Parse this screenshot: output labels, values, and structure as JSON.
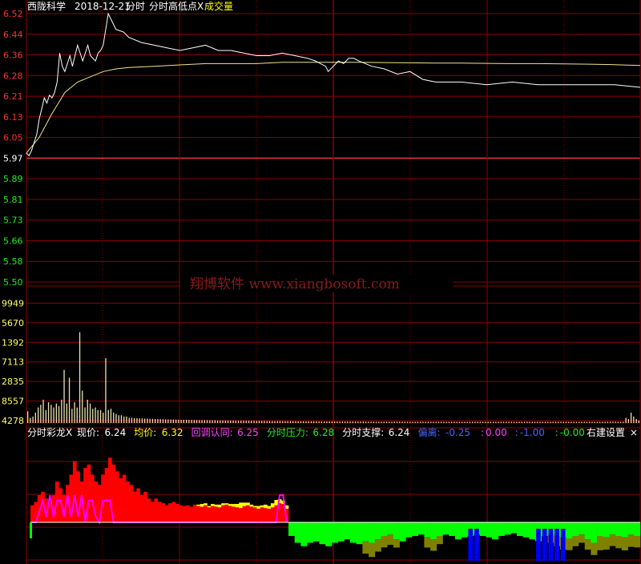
{
  "header": {
    "stock_name": "西陇科学",
    "date": "2018-12-21",
    "mode": "分时",
    "indicator": "分时高低点X",
    "indicator2": "成交量"
  },
  "watermark": "翔博软件 www.xiangbosoft.com",
  "colors": {
    "background": "#000000",
    "grid": "#8b0000",
    "price_line": "#ffffff",
    "avg_line": "#f0e68c",
    "up_label": "#ff3030",
    "down_label": "#22ee22",
    "volume": "#e8e4b0",
    "red_bar": "#ff0000",
    "yellow_bar": "#ffff00",
    "green_bar": "#00ff00",
    "blue_bar": "#0000ff",
    "magenta": "#ff00ff",
    "olive": "#808000"
  },
  "indicator_bar": {
    "name": "分时彩龙X",
    "items": [
      {
        "label": "现价:",
        "value": "6.24",
        "color": "#ffffff"
      },
      {
        "label": "均价:",
        "value": "6.32",
        "color": "#ffff00"
      },
      {
        "label": "回调认同:",
        "value": "6.25",
        "color": "#ff40ff"
      },
      {
        "label": "分时压力:",
        "value": "6.28",
        "color": "#22ee22"
      },
      {
        "label": "分时支撑:",
        "value": "6.24",
        "color": "#ffffff"
      },
      {
        "label": "偏离:",
        "value": "-0.25",
        "color": "#4466ff"
      },
      {
        "label": ":",
        "value": "0.00",
        "color": "#ff40ff"
      },
      {
        "label": ":",
        "value": "-1.00",
        "color": "#4466ff"
      },
      {
        "label": ":",
        "value": "-0.00",
        "color": "#22ee22"
      }
    ],
    "settings_label": "右建设置",
    "close_label": "×"
  },
  "chart_data": [
    {
      "type": "line",
      "name": "price_chart",
      "y_ticks": [
        "6.52",
        "6.44",
        "6.36",
        "6.28",
        "6.21",
        "6.13",
        "6.05",
        "5.97",
        "5.89",
        "5.81",
        "5.73",
        "5.66",
        "5.58",
        "5.50"
      ],
      "prev_close": 5.97,
      "ylim": [
        5.46,
        6.52
      ],
      "series": [
        {
          "role": "price",
          "x": [
            0,
            1,
            2,
            3,
            4,
            5,
            6,
            7,
            8,
            9,
            10,
            11,
            12,
            13,
            14,
            15,
            16,
            17,
            18,
            19,
            20,
            22,
            24,
            25,
            27,
            28,
            29,
            30,
            32,
            35,
            38,
            40,
            45,
            50,
            55,
            60,
            65,
            70,
            75,
            80,
            85,
            90,
            95,
            100,
            105,
            110,
            113,
            115,
            117,
            118,
            120,
            122,
            124,
            126,
            128,
            130,
            135,
            140,
            145,
            150,
            155,
            160,
            170,
            180,
            190,
            200,
            210,
            220,
            230,
            240
          ],
          "y": [
            5.99,
            5.98,
            6.0,
            6.03,
            6.06,
            6.12,
            6.16,
            6.2,
            6.18,
            6.21,
            6.2,
            6.22,
            6.26,
            6.37,
            6.32,
            6.3,
            6.33,
            6.36,
            6.32,
            6.36,
            6.4,
            6.34,
            6.4,
            6.36,
            6.34,
            6.37,
            6.38,
            6.4,
            6.52,
            6.46,
            6.45,
            6.43,
            6.41,
            6.4,
            6.39,
            6.38,
            6.39,
            6.4,
            6.38,
            6.38,
            6.37,
            6.36,
            6.36,
            6.37,
            6.36,
            6.35,
            6.34,
            6.33,
            6.32,
            6.3,
            6.32,
            6.34,
            6.33,
            6.35,
            6.35,
            6.34,
            6.32,
            6.31,
            6.29,
            6.3,
            6.27,
            6.26,
            6.26,
            6.25,
            6.26,
            6.25,
            6.25,
            6.25,
            6.25,
            6.24
          ]
        },
        {
          "role": "average",
          "x": [
            0,
            5,
            10,
            15,
            20,
            25,
            30,
            35,
            40,
            50,
            60,
            70,
            80,
            90,
            100,
            110,
            120,
            130,
            140,
            150,
            160,
            170,
            180,
            190,
            200,
            210,
            220,
            230,
            240
          ],
          "y": [
            5.99,
            6.05,
            6.14,
            6.22,
            6.26,
            6.28,
            6.3,
            6.31,
            6.315,
            6.32,
            6.325,
            6.33,
            6.33,
            6.33,
            6.335,
            6.335,
            6.335,
            6.335,
            6.334,
            6.333,
            6.332,
            6.332,
            6.331,
            6.33,
            6.33,
            6.329,
            6.328,
            6.326,
            6.323
          ]
        }
      ],
      "xlim": [
        0,
        240
      ]
    },
    {
      "type": "bar",
      "name": "volume_chart",
      "y_ticks": [
        "9949",
        "5670",
        "1392",
        "7113",
        "2835",
        "8557",
        "4278"
      ],
      "ylim": [
        0,
        9949
      ],
      "values": [
        900,
        400,
        500,
        800,
        1200,
        1400,
        1800,
        1000,
        1600,
        1400,
        1200,
        1500,
        1300,
        1800,
        4100,
        1500,
        3500,
        1100,
        1600,
        1200,
        7000,
        2500,
        1200,
        1800,
        1500,
        1100,
        1200,
        1000,
        1000,
        800,
        5000,
        1000,
        1100,
        800,
        700,
        600,
        600,
        500,
        500,
        400,
        400,
        380,
        380,
        360,
        360,
        340,
        340,
        320,
        320,
        310,
        300,
        300,
        290,
        280,
        280,
        270,
        270,
        260,
        260,
        250,
        250,
        250,
        240,
        240,
        230,
        230,
        230,
        220,
        220,
        220,
        210,
        210,
        210,
        200,
        200,
        200,
        190,
        190,
        190,
        190,
        180,
        180,
        180,
        180,
        170,
        170,
        170,
        170,
        160,
        160,
        160,
        160,
        150,
        150,
        150,
        150,
        150,
        150,
        140,
        140,
        140,
        140,
        140,
        140,
        130,
        130,
        130,
        130,
        130,
        130,
        130,
        130,
        120,
        120,
        120,
        120,
        120,
        120,
        120,
        120,
        110,
        110,
        110,
        110,
        110,
        110,
        110,
        110,
        110,
        110,
        100,
        100,
        100,
        100,
        100,
        100,
        100,
        100,
        100,
        100,
        100,
        100,
        100,
        100,
        100,
        100,
        95,
        95,
        95,
        95,
        95,
        95,
        95,
        95,
        95,
        95,
        90,
        90,
        90,
        90,
        90,
        90,
        90,
        90,
        90,
        90,
        90,
        90,
        90,
        90,
        90,
        90,
        90,
        90,
        90,
        90,
        90,
        90,
        90,
        90,
        90,
        90,
        90,
        90,
        90,
        90,
        90,
        90,
        90,
        90,
        90,
        90,
        90,
        90,
        90,
        90,
        90,
        90,
        90,
        90,
        90,
        90,
        90,
        90,
        90,
        90,
        90,
        90,
        90,
        90,
        90,
        90,
        90,
        90,
        90,
        90,
        90,
        90,
        90,
        90,
        90,
        90,
        90,
        90,
        90,
        90,
        90,
        90,
        90,
        90,
        400,
        300,
        800,
        500,
        300,
        200
      ]
    },
    {
      "type": "bar",
      "name": "indicator_chart",
      "zero_level": 0,
      "ylim": [
        -60,
        120
      ],
      "positive_red": [
        25,
        30,
        40,
        45,
        35,
        28,
        40,
        60,
        50,
        40,
        55,
        70,
        90,
        75,
        60,
        80,
        85,
        70,
        60,
        55,
        70,
        80,
        95,
        85,
        75,
        65,
        70,
        60,
        55,
        45,
        50,
        40,
        45,
        35,
        30,
        35,
        30,
        28,
        25,
        28,
        30,
        27,
        25,
        24,
        25,
        23,
        26,
        24,
        23,
        25,
        22,
        24,
        23,
        22,
        25,
        26,
        24,
        23,
        22,
        21,
        24,
        25,
        23,
        22,
        20,
        22,
        21,
        20,
        22,
        25,
        28,
        27,
        20
      ],
      "positive_yellow_extra": [
        0,
        0,
        0,
        0,
        0,
        0,
        0,
        0,
        0,
        0,
        0,
        0,
        0,
        0,
        0,
        0,
        0,
        0,
        0,
        0,
        0,
        0,
        0,
        0,
        0,
        0,
        0,
        0,
        0,
        0,
        0,
        0,
        0,
        0,
        0,
        0,
        0,
        0,
        0,
        0,
        0,
        0,
        0,
        0,
        0,
        0,
        0,
        2,
        4,
        3,
        2,
        3,
        3,
        4,
        3,
        2,
        3,
        4,
        5,
        8,
        5,
        4,
        3,
        2,
        4,
        3,
        5,
        4,
        6,
        8,
        6,
        5,
        5
      ],
      "magenta_line": [
        0,
        0,
        10,
        20,
        5,
        25,
        5,
        20,
        20,
        5,
        25,
        5,
        25,
        5,
        25,
        0,
        20,
        20,
        5,
        0,
        20,
        20,
        20,
        0,
        0,
        0,
        0,
        0,
        0,
        0,
        0,
        0,
        0,
        0,
        0,
        0,
        0,
        0,
        0,
        0,
        0,
        0,
        0,
        0,
        0,
        0,
        0,
        0,
        0,
        0,
        0,
        0,
        0,
        0,
        0,
        0,
        0,
        0,
        0,
        0,
        0,
        0,
        0,
        0,
        0,
        0,
        0,
        0,
        0,
        0,
        25,
        25,
        0
      ],
      "negative_green": [
        -20,
        -30,
        -35,
        -30,
        -28,
        -32,
        -35,
        -30,
        -28,
        -25,
        -30,
        -32,
        -28,
        -30,
        -25,
        -20,
        -18,
        -25,
        -28,
        -22,
        -20,
        -18,
        -22,
        -25,
        -20,
        -18,
        -20,
        -25,
        -22,
        -20,
        -18,
        -20,
        -22,
        -25,
        -20,
        -18,
        -16,
        -20,
        -22,
        -25,
        -28,
        -20,
        -18,
        -20,
        -22,
        -24,
        -20,
        -18,
        -25,
        -30,
        -20,
        -22,
        -18,
        -20,
        -22,
        -18,
        -20
      ],
      "negative_olive": [
        0,
        0,
        0,
        0,
        0,
        0,
        0,
        0,
        0,
        0,
        0,
        0,
        -30,
        -35,
        -30,
        -28,
        -25,
        -20,
        0,
        0,
        0,
        0,
        -25,
        -28,
        -20,
        0,
        0,
        0,
        0,
        0,
        0,
        0,
        0,
        0,
        0,
        0,
        0,
        0,
        0,
        0,
        0,
        0,
        -20,
        -25,
        -30,
        -28,
        -25,
        -20,
        -25,
        -30,
        -35,
        -30,
        -28,
        -30,
        -32,
        -30,
        -28
      ],
      "blue_bars_index": [
        29,
        30,
        40,
        41,
        42,
        43,
        44
      ]
    }
  ]
}
